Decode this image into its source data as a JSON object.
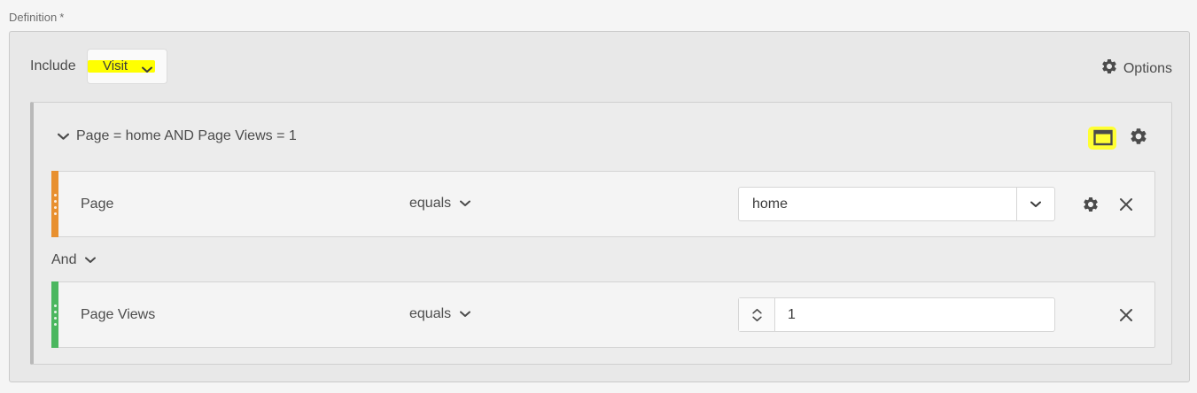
{
  "definition": {
    "label": "Definition",
    "required_mark": "*"
  },
  "header": {
    "include_label": "Include",
    "scope_value": "Visit",
    "options_label": "Options"
  },
  "container": {
    "title": "Page = home AND Page Views = 1"
  },
  "rules": [
    {
      "dimension": "Page",
      "operator": "equals",
      "value": "home",
      "accent_color": "#e8902f"
    },
    {
      "dimension": "Page Views",
      "operator": "equals",
      "value": "1",
      "accent_color": "#4bb75f"
    }
  ],
  "logic_operator": "And",
  "colors": {
    "highlight": "#ffff00",
    "page_background": "#f5f5f5",
    "panel_background": "#e8e8e8",
    "icon": "#4b4b4b"
  },
  "icons": {
    "options": "gear-icon",
    "container_collapse": "chevron-down-icon",
    "container_window": "window-icon",
    "container_settings": "gear-icon",
    "rule_remove": "close-icon",
    "rule_settings": "gear-icon",
    "stepper": "stepper-icon"
  }
}
